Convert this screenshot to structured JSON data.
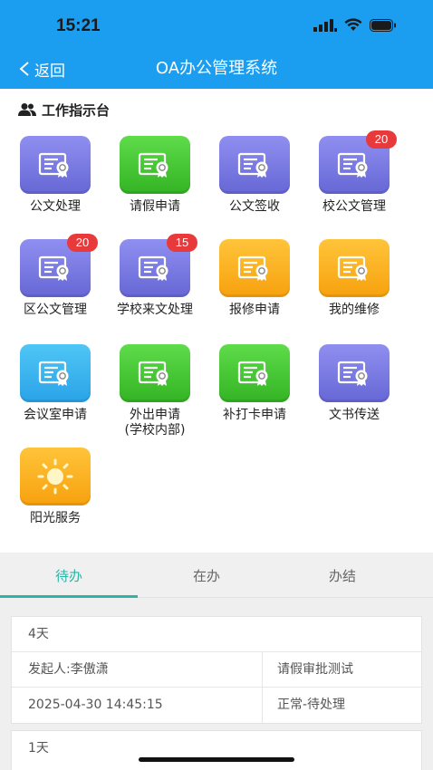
{
  "status_bar": {
    "time": "15:21"
  },
  "nav": {
    "back_label": "返回",
    "title": "OA办公管理系统"
  },
  "workbench": {
    "title": "工作指示台",
    "items": [
      {
        "label": "公文处理",
        "color": "purple",
        "icon": "certificate-icon",
        "badge": ""
      },
      {
        "label": "请假申请",
        "color": "green",
        "icon": "certificate-icon",
        "badge": ""
      },
      {
        "label": "公文签收",
        "color": "purple",
        "icon": "certificate-icon",
        "badge": ""
      },
      {
        "label": "校公文管理",
        "color": "purple",
        "icon": "certificate-icon",
        "badge": "20"
      },
      {
        "label": "区公文管理",
        "color": "purple",
        "icon": "certificate-icon",
        "badge": "20"
      },
      {
        "label": "学校来文处理",
        "color": "purple",
        "icon": "certificate-icon",
        "badge": "15"
      },
      {
        "label": "报修申请",
        "color": "orange",
        "icon": "certificate-icon",
        "badge": ""
      },
      {
        "label": "我的维修",
        "color": "orange",
        "icon": "certificate-icon",
        "badge": ""
      },
      {
        "label": "会议室申请",
        "color": "blue",
        "icon": "certificate-icon",
        "badge": ""
      },
      {
        "label": "外出申请\n(学校内部)",
        "color": "green",
        "icon": "certificate-icon",
        "badge": ""
      },
      {
        "label": "补打卡申请",
        "color": "green",
        "icon": "certificate-icon",
        "badge": ""
      },
      {
        "label": "文书传送",
        "color": "purple",
        "icon": "certificate-icon",
        "badge": ""
      },
      {
        "label": "阳光服务",
        "color": "orange",
        "icon": "sun-icon",
        "badge": ""
      }
    ]
  },
  "tabs": [
    {
      "label": "待办",
      "active": true
    },
    {
      "label": "在办",
      "active": false
    },
    {
      "label": "办结",
      "active": false
    }
  ],
  "cards": [
    {
      "duration": "4天",
      "initiator": "发起人:李傲潇",
      "subject": "请假审批测试",
      "datetime": "2025-04-30 14:45:15",
      "status": "正常-待处理"
    },
    {
      "duration": "1天"
    }
  ],
  "colors": {
    "header": "#1b9df0",
    "accent": "#2bb5a6",
    "badge": "#e8393b"
  }
}
